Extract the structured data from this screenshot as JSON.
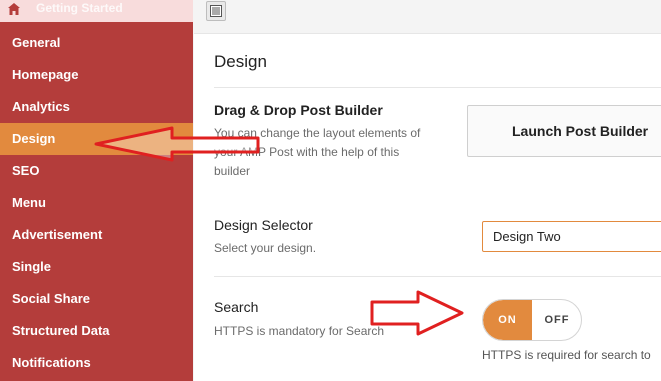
{
  "sidebar": {
    "top_label": "Getting Started",
    "items": [
      {
        "label": "General"
      },
      {
        "label": "Homepage"
      },
      {
        "label": "Analytics"
      },
      {
        "label": "Design",
        "active": true
      },
      {
        "label": "SEO"
      },
      {
        "label": "Menu"
      },
      {
        "label": "Advertisement"
      },
      {
        "label": "Single"
      },
      {
        "label": "Social Share"
      },
      {
        "label": "Structured Data"
      },
      {
        "label": "Notifications"
      }
    ]
  },
  "main": {
    "title": "Design",
    "builder": {
      "label": "Drag & Drop Post Builder",
      "desc_line1": "You can change the layout elements of",
      "desc_line2": "your AMP Post with the help of this",
      "desc_line3": "builder",
      "button_label": "Launch Post Builder"
    },
    "design_selector": {
      "label": "Design Selector",
      "desc": "Select your design.",
      "value": "Design Two"
    },
    "search": {
      "label": "Search",
      "desc": "HTTPS is mandatory for Search",
      "toggle_on": "ON",
      "toggle_off": "OFF",
      "state": "on",
      "note": "HTTPS is required for search to"
    }
  },
  "colors": {
    "sidebar_bg": "#b43d3b",
    "active_accent": "#e28a3e",
    "annotation_arrow": "#e02020"
  },
  "icons": [
    "home-icon",
    "layout-icon"
  ]
}
